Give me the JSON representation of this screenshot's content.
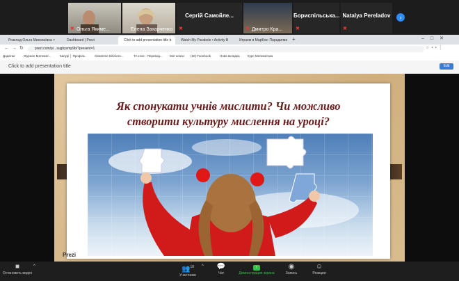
{
  "participants": [
    {
      "name": "Ольга Якиме...",
      "type": "video"
    },
    {
      "name": "Елена Захарченко",
      "type": "video"
    },
    {
      "name": "Сергій Самойле...",
      "type": "name"
    },
    {
      "name": "Дмитро Кра...",
      "type": "video"
    },
    {
      "name": "Бориспільська...",
      "type": "name"
    },
    {
      "name": "Natalya Pereladov",
      "type": "name"
    }
  ],
  "browser": {
    "tabs": [
      "Розклад Ольга Миколаївна ×",
      "Dashboard | Prezi",
      "Click to add presentation title b",
      "Watch My Parabole • Activity B",
      "Играем в МарБок: Парадигми"
    ],
    "url": "prezi.com/p/...sugbyxmp9b/?present=1",
    "bookmarks": [
      "Додатки",
      "Журнал Математ...",
      "Капурі │ Профіль",
      "Classtime Бібліоте...",
      "TA клас - Перевод...",
      "Мої класи",
      "(10) Facebook",
      "Нова вкладка",
      "Курс Математика"
    ],
    "presentation_title": "Click to add presentation title",
    "edit_label": "Edit"
  },
  "slide": {
    "question_line1": "Як спонукати учнів мислити? Чи можливо",
    "question_line2": "створити культуру мислення на уроці?",
    "logo": "Prezi"
  },
  "toolbar": {
    "stop_video": "Остановить видео",
    "participants": "Участники",
    "participants_count": "18",
    "chat": "Чат",
    "share_screen": "Демонстрация экрана",
    "record": "Запись",
    "reactions": "Реакции"
  },
  "colors": {
    "share_green": "#33c24a",
    "title_red": "#6b1a1a",
    "edit_blue": "#3a7bd5"
  }
}
